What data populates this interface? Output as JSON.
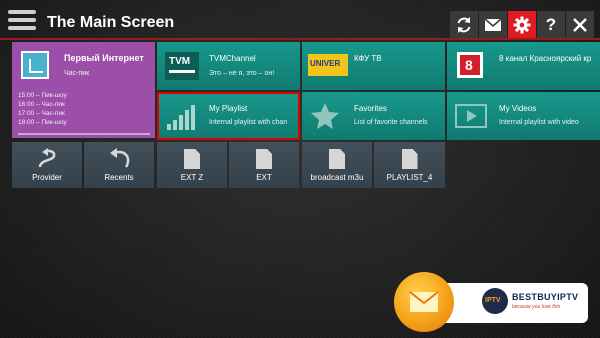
{
  "header": {
    "title": "The Main Screen"
  },
  "toolbar": {
    "buttons": [
      {
        "icon": "refresh-icon"
      },
      {
        "icon": "mail-icon"
      },
      {
        "icon": "settings-gear-icon",
        "active": true
      },
      {
        "icon": "help-icon"
      },
      {
        "icon": "close-icon"
      }
    ],
    "active_color": "#e01b24"
  },
  "epg_tile": {
    "channel": "Первый Интернет",
    "now": "Час-пик",
    "schedule": [
      "15:00 – Пик-шоу",
      "16:00 – Час-пик",
      "17:00 – Час-пик",
      "18:00 – Пик-шоу"
    ]
  },
  "channels": [
    {
      "name": "TVMChannel",
      "desc": "Это – не я, это – он!",
      "logo": "TVM"
    },
    {
      "name": "КФУ ТВ",
      "desc": "",
      "logo": "UNIVER"
    },
    {
      "name": "8 канал Красноярский кр",
      "desc": "",
      "logo": "8"
    }
  ],
  "features": [
    {
      "name": "My Playlist",
      "desc": "Internal playlist with chan",
      "icon": "signal-bars-icon",
      "selected": true
    },
    {
      "name": "Favorites",
      "desc": "List of favorite channels",
      "icon": "star-icon"
    },
    {
      "name": "My Videos",
      "desc": "Internal playlist with video",
      "icon": "video-play-icon"
    }
  ],
  "shortcuts": [
    {
      "label": "Provider",
      "icon": "route-arrow-icon"
    },
    {
      "label": "Recents",
      "icon": "undo-arrow-icon"
    },
    {
      "label": "EXT Z",
      "icon": "document-icon"
    },
    {
      "label": "EXT",
      "icon": "document-icon"
    },
    {
      "label": "broadcast m3u",
      "icon": "document-icon"
    },
    {
      "label": "PLAYLIST_4",
      "icon": "document-icon"
    }
  ],
  "promo": {
    "brand": "BESTBUYIPTV",
    "tagline": "because you love this",
    "logo": "IPTV"
  },
  "colors": {
    "teal": "#17998c",
    "purple": "#9b4fa8",
    "grey_tile": "#3d4a55",
    "accent_red": "#e00000"
  }
}
